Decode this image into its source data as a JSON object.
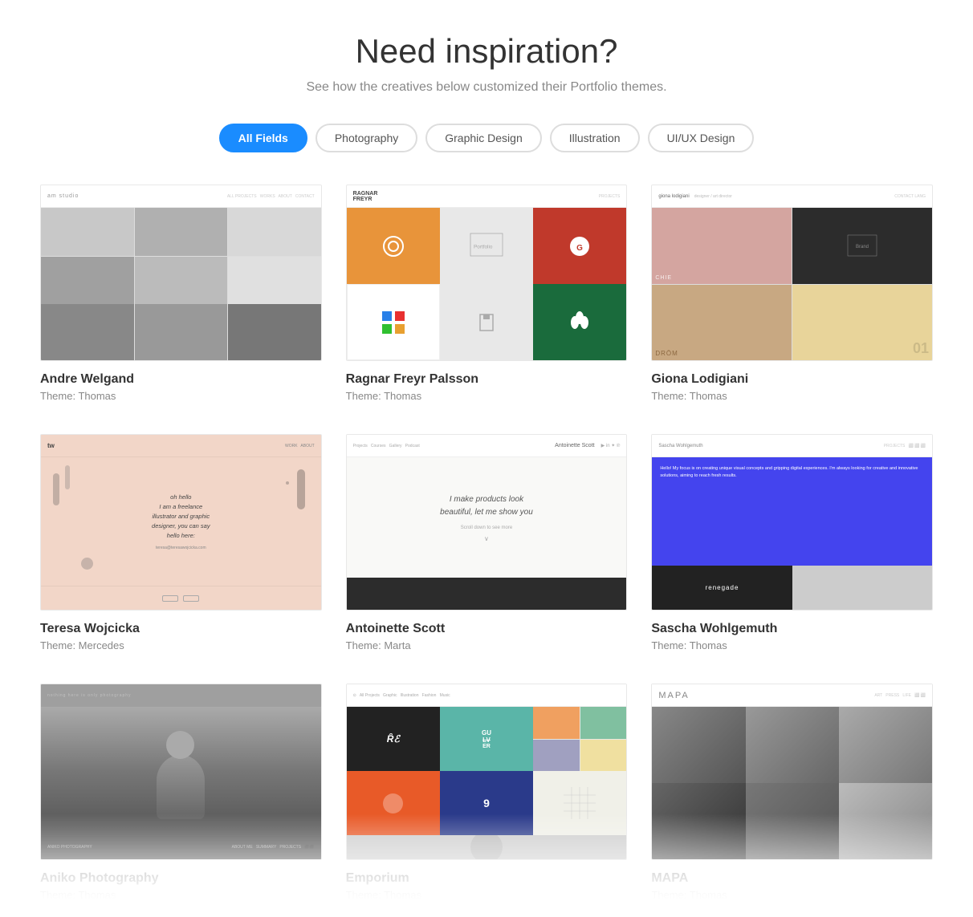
{
  "header": {
    "title": "Need inspiration?",
    "subtitle": "See how the creatives below customized their Portfolio themes."
  },
  "filters": {
    "items": [
      {
        "id": "all",
        "label": "All Fields",
        "active": true
      },
      {
        "id": "photography",
        "label": "Photography",
        "active": false
      },
      {
        "id": "graphic-design",
        "label": "Graphic Design",
        "active": false
      },
      {
        "id": "illustration",
        "label": "Illustration",
        "active": false
      },
      {
        "id": "uiux",
        "label": "UI/UX Design",
        "active": false
      }
    ]
  },
  "gallery": {
    "items": [
      {
        "id": "andre",
        "name": "Andre Welgand",
        "theme": "Theme: Thomas"
      },
      {
        "id": "ragnar",
        "name": "Ragnar Freyr Palsson",
        "theme": "Theme: Thomas"
      },
      {
        "id": "giona",
        "name": "Giona Lodigiani",
        "theme": "Theme: Thomas"
      },
      {
        "id": "teresa",
        "name": "Teresa Wojcicka",
        "theme": "Theme: Mercedes"
      },
      {
        "id": "antoinette",
        "name": "Antoinette Scott",
        "theme": "Theme: Marta"
      },
      {
        "id": "sascha",
        "name": "Sascha Wohlgemuth",
        "theme": "Theme: Thomas"
      },
      {
        "id": "aniko",
        "name": "Aniko Photography",
        "theme": "Theme: Thomas"
      },
      {
        "id": "emporium",
        "name": "Emporium",
        "theme": "Theme: Thomas"
      },
      {
        "id": "mapa",
        "name": "MAPA",
        "theme": "Theme: Thomas"
      }
    ]
  },
  "colors": {
    "accent": "#1a8cff",
    "text_primary": "#333",
    "text_secondary": "#888",
    "border": "#ddd"
  }
}
